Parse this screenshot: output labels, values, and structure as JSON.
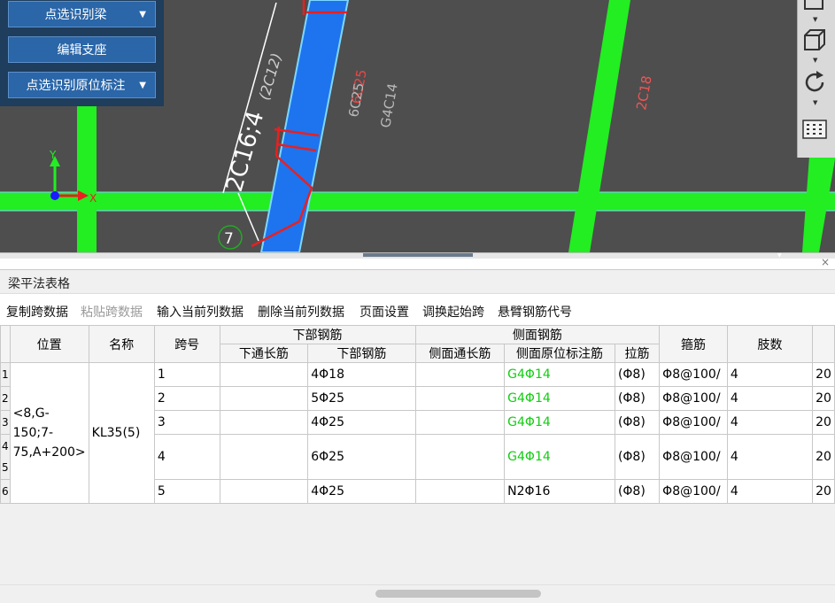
{
  "left_panel": {
    "btn1": "点选识别梁",
    "btn2": "编辑支座",
    "btn3": "点选识别原位标注"
  },
  "canvas": {
    "annotation_main": "2C16;4",
    "annotation_paren": "(2C12)",
    "ann_6c25_red": "6C25",
    "ann_6c25_grey": "6C25",
    "ann_g4c14": "G4C14",
    "ann_2c18": "2C18",
    "axis_bubble": "7",
    "axis_x": "X",
    "axis_y": "Y"
  },
  "panel": {
    "title": "梁平法表格",
    "close": "×"
  },
  "toolbar": {
    "copy": "复制跨数据",
    "paste": "粘贴跨数据",
    "input_col": "输入当前列数据",
    "delete_col": "删除当前列数据",
    "page_setup": "页面设置",
    "swap_start": "调换起始跨",
    "cantilever": "悬臂钢筋代号"
  },
  "table": {
    "headers": {
      "position": "位置",
      "name": "名称",
      "span": "跨号",
      "bottom_group": "下部钢筋",
      "bottom_through": "下通长筋",
      "bottom_bar": "下部钢筋",
      "side_group": "侧面钢筋",
      "side_through": "侧面通长筋",
      "side_orig": "侧面原位标注筋",
      "tie": "拉筋",
      "stirrup": "箍筋",
      "legs": "肢数"
    },
    "position_value": "<8,G-150;7-75,A+200>",
    "name_value": "KL35(5)",
    "rows": [
      {
        "rn": "1",
        "span": "1",
        "bottom_through": "",
        "bottom": "4Φ18",
        "side_through": "",
        "side_orig": "G4Φ14",
        "tie": "(Φ8)",
        "stirrup": "Φ8@100/",
        "legs": "4",
        "extra": "20"
      },
      {
        "rn": "2",
        "span": "2",
        "bottom_through": "",
        "bottom": "5Φ25",
        "side_through": "",
        "side_orig": "G4Φ14",
        "tie": "(Φ8)",
        "stirrup": "Φ8@100/",
        "legs": "4",
        "extra": "20"
      },
      {
        "rn": "3",
        "span": "3",
        "bottom_through": "",
        "bottom": "4Φ25",
        "side_through": "",
        "side_orig": "G4Φ14",
        "tie": "(Φ8)",
        "stirrup": "Φ8@100/",
        "legs": "4",
        "extra": "20"
      },
      {
        "rn": "4",
        "rn2": "5",
        "span": "4",
        "bottom_through": "",
        "bottom": "6Φ25",
        "side_through": "",
        "side_orig": "G4Φ14",
        "tie": "(Φ8)",
        "stirrup": "Φ8@100/",
        "legs": "4",
        "extra": "20"
      },
      {
        "rn": "6",
        "span": "5",
        "bottom_through": "",
        "bottom": "4Φ25",
        "side_through": "",
        "side_orig": "N2Φ16",
        "tie": "(Φ8)",
        "stirrup": "Φ8@100/",
        "legs": "4",
        "extra": "20"
      }
    ]
  },
  "colors": {
    "canvas_bg": "#4e4e4e",
    "beam_green": "#22ee22",
    "beam_blue": "#1e74ee",
    "rebar_red": "#e82020",
    "text_green": "#12cc12",
    "panel_blue": "#1f3d5c",
    "button_blue": "#2a66a8"
  }
}
